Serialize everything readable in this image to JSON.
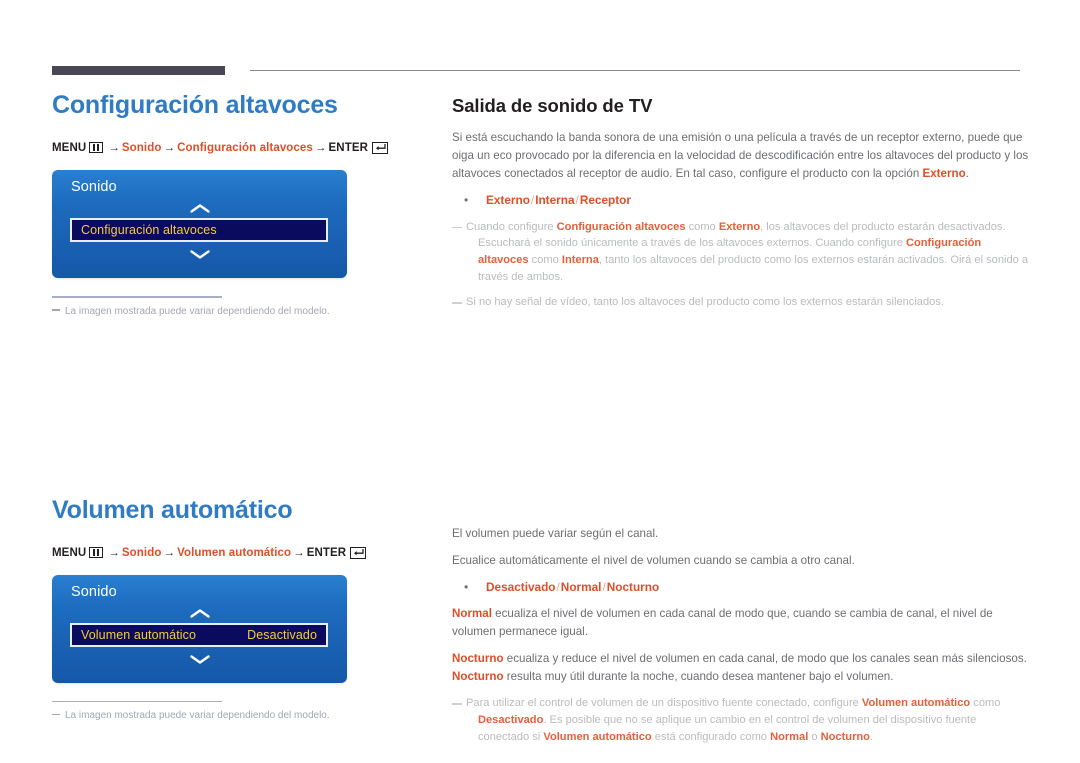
{
  "header": {
    "rule_dark_color": "#4a4755",
    "rule_thin_color": "#8a8a90"
  },
  "colors": {
    "heading_blue": "#2f7cc4",
    "accent_orange": "#e04e27",
    "osd_blue": "#1d6dc0",
    "osd_row_navy": "#0a0a5e",
    "osd_row_text": "#f4cf31",
    "body_gray": "#6d6e71",
    "note_gray": "#b9bbbd"
  },
  "sections": [
    {
      "title": "Configuración altavoces",
      "menu_path": {
        "menu_label": "MENU",
        "menu_icon": "menu-grid-icon",
        "arrow": "→",
        "step1": "Sonido",
        "step2": "Configuración altavoces",
        "enter_label": "ENTER",
        "enter_icon": "enter-return-icon"
      },
      "osd": {
        "title": "Sonido",
        "up_icon": "chevron-up-icon",
        "down_icon": "chevron-down-icon",
        "row_label": "Configuración altavoces",
        "row_value": ""
      },
      "footnote": "La imagen mostrada puede variar dependiendo del modelo."
    },
    {
      "title": "Volumen automático",
      "menu_path": {
        "menu_label": "MENU",
        "menu_icon": "menu-grid-icon",
        "arrow": "→",
        "step1": "Sonido",
        "step2": "Volumen automático",
        "enter_label": "ENTER",
        "enter_icon": "enter-return-icon"
      },
      "osd": {
        "title": "Sonido",
        "up_icon": "chevron-up-icon",
        "down_icon": "chevron-down-icon",
        "row_label": "Volumen automático",
        "row_value": "Desactivado"
      },
      "footnote": "La imagen mostrada puede variar dependiendo del modelo."
    }
  ],
  "right": {
    "block1": {
      "title": "Salida de sonido de TV",
      "para1_a": "Si está escuchando la banda sonora de una emisión o una película a través de un receptor externo, puede que oiga un eco provocado por la diferencia en la velocidad de descodificación entre los altavoces del producto y los altavoces conectados al receptor de audio. En tal caso, configure el producto con la opción ",
      "para1_b": "Externo",
      "para1_c": ".",
      "options": {
        "o1": "Externo",
        "s1": "/",
        "o2": "Interna",
        "s2": "/",
        "o3": "Receptor"
      },
      "note1": {
        "t1": "Cuando configure ",
        "b1": "Configuración altavoces",
        "t2": " como ",
        "b2": "Externo",
        "t3": ", los altavoces del producto estarán desactivados.",
        "t4": "Escuchará el sonido únicamente a través de los altavoces externos. Cuando configure ",
        "b3": "Configuración altavoces",
        "t5": " como ",
        "b4": "Interna",
        "t6": ", tanto los altavoces del producto como los externos estarán activados. Oirá el sonido a través de ambos."
      },
      "note2": "Si no hay señal de vídeo, tanto los altavoces del producto como los externos estarán silenciados."
    },
    "block2": {
      "para1": "El volumen puede variar según el canal.",
      "para2": "Ecualice automáticamente el nivel de volumen cuando se cambia a otro canal.",
      "options": {
        "o1": "Desactivado",
        "s1": "/",
        "o2": "Normal",
        "s2": "/",
        "o3": "Nocturno"
      },
      "para3_a": "Normal",
      "para3_b": " ecualiza el nivel de volumen en cada canal de modo que, cuando se cambia de canal, el nivel de volumen permanece igual.",
      "para4_a": "Nocturno",
      "para4_b": " ecualiza y reduce el nivel de volumen en cada canal, de modo que los canales sean más silenciosos. ",
      "para4_c": "Nocturno",
      "para4_d": " resulta muy útil durante la noche, cuando desea mantener bajo el volumen.",
      "note1": {
        "t1": "Para utilizar el control de volumen de un dispositivo fuente conectado, configure ",
        "b1": "Volumen automático",
        "t2": " como ",
        "b2": "Desactivado",
        "t3": ". Es posible que no se aplique un cambio en el control de volumen del dispositivo fuente conectado si ",
        "b3": "Volumen automático",
        "t4": " está configurado como ",
        "b4": "Normal",
        "t5": " o ",
        "b5": "Nocturno",
        "t6": "."
      }
    }
  }
}
